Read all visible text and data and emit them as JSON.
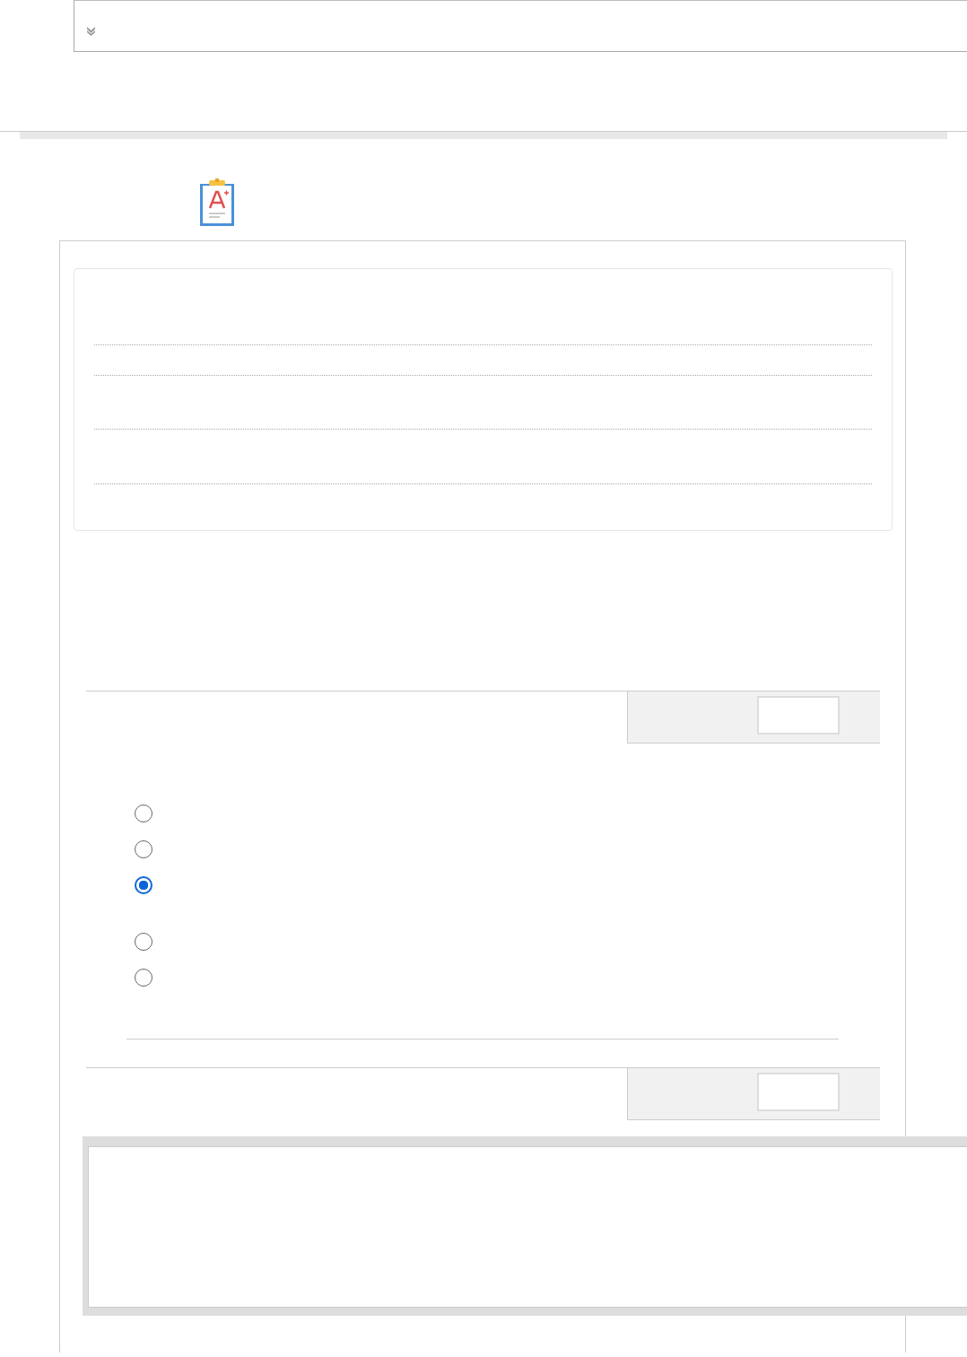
{
  "answer_options": [
    {
      "selected": false
    },
    {
      "selected": false
    },
    {
      "selected": true
    },
    {
      "selected": false
    },
    {
      "selected": false
    }
  ]
}
